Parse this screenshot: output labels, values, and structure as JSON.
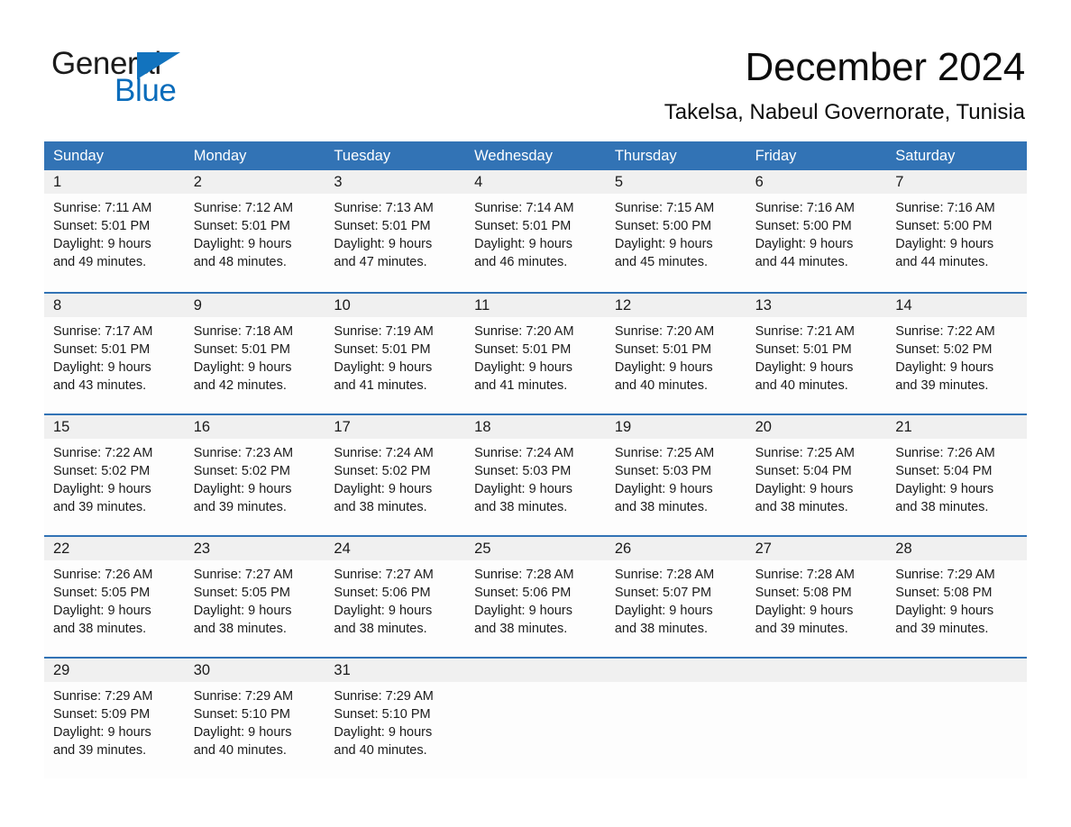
{
  "brand": {
    "name_part1": "General",
    "name_part2": "Blue",
    "accent_color": "#1273be",
    "blue_text_color": "#0a6cbb"
  },
  "header": {
    "month_title": "December 2024",
    "location": "Takelsa, Nabeul Governorate, Tunisia"
  },
  "calendar": {
    "header_color": "#3273b5",
    "day_band_color": "#f0f0f0",
    "weekdays": [
      "Sunday",
      "Monday",
      "Tuesday",
      "Wednesday",
      "Thursday",
      "Friday",
      "Saturday"
    ],
    "weeks": [
      [
        {
          "day": "1",
          "sunrise": "Sunrise: 7:11 AM",
          "sunset": "Sunset: 5:01 PM",
          "daylight_line1": "Daylight: 9 hours",
          "daylight_line2": "and 49 minutes."
        },
        {
          "day": "2",
          "sunrise": "Sunrise: 7:12 AM",
          "sunset": "Sunset: 5:01 PM",
          "daylight_line1": "Daylight: 9 hours",
          "daylight_line2": "and 48 minutes."
        },
        {
          "day": "3",
          "sunrise": "Sunrise: 7:13 AM",
          "sunset": "Sunset: 5:01 PM",
          "daylight_line1": "Daylight: 9 hours",
          "daylight_line2": "and 47 minutes."
        },
        {
          "day": "4",
          "sunrise": "Sunrise: 7:14 AM",
          "sunset": "Sunset: 5:01 PM",
          "daylight_line1": "Daylight: 9 hours",
          "daylight_line2": "and 46 minutes."
        },
        {
          "day": "5",
          "sunrise": "Sunrise: 7:15 AM",
          "sunset": "Sunset: 5:00 PM",
          "daylight_line1": "Daylight: 9 hours",
          "daylight_line2": "and 45 minutes."
        },
        {
          "day": "6",
          "sunrise": "Sunrise: 7:16 AM",
          "sunset": "Sunset: 5:00 PM",
          "daylight_line1": "Daylight: 9 hours",
          "daylight_line2": "and 44 minutes."
        },
        {
          "day": "7",
          "sunrise": "Sunrise: 7:16 AM",
          "sunset": "Sunset: 5:00 PM",
          "daylight_line1": "Daylight: 9 hours",
          "daylight_line2": "and 44 minutes."
        }
      ],
      [
        {
          "day": "8",
          "sunrise": "Sunrise: 7:17 AM",
          "sunset": "Sunset: 5:01 PM",
          "daylight_line1": "Daylight: 9 hours",
          "daylight_line2": "and 43 minutes."
        },
        {
          "day": "9",
          "sunrise": "Sunrise: 7:18 AM",
          "sunset": "Sunset: 5:01 PM",
          "daylight_line1": "Daylight: 9 hours",
          "daylight_line2": "and 42 minutes."
        },
        {
          "day": "10",
          "sunrise": "Sunrise: 7:19 AM",
          "sunset": "Sunset: 5:01 PM",
          "daylight_line1": "Daylight: 9 hours",
          "daylight_line2": "and 41 minutes."
        },
        {
          "day": "11",
          "sunrise": "Sunrise: 7:20 AM",
          "sunset": "Sunset: 5:01 PM",
          "daylight_line1": "Daylight: 9 hours",
          "daylight_line2": "and 41 minutes."
        },
        {
          "day": "12",
          "sunrise": "Sunrise: 7:20 AM",
          "sunset": "Sunset: 5:01 PM",
          "daylight_line1": "Daylight: 9 hours",
          "daylight_line2": "and 40 minutes."
        },
        {
          "day": "13",
          "sunrise": "Sunrise: 7:21 AM",
          "sunset": "Sunset: 5:01 PM",
          "daylight_line1": "Daylight: 9 hours",
          "daylight_line2": "and 40 minutes."
        },
        {
          "day": "14",
          "sunrise": "Sunrise: 7:22 AM",
          "sunset": "Sunset: 5:02 PM",
          "daylight_line1": "Daylight: 9 hours",
          "daylight_line2": "and 39 minutes."
        }
      ],
      [
        {
          "day": "15",
          "sunrise": "Sunrise: 7:22 AM",
          "sunset": "Sunset: 5:02 PM",
          "daylight_line1": "Daylight: 9 hours",
          "daylight_line2": "and 39 minutes."
        },
        {
          "day": "16",
          "sunrise": "Sunrise: 7:23 AM",
          "sunset": "Sunset: 5:02 PM",
          "daylight_line1": "Daylight: 9 hours",
          "daylight_line2": "and 39 minutes."
        },
        {
          "day": "17",
          "sunrise": "Sunrise: 7:24 AM",
          "sunset": "Sunset: 5:02 PM",
          "daylight_line1": "Daylight: 9 hours",
          "daylight_line2": "and 38 minutes."
        },
        {
          "day": "18",
          "sunrise": "Sunrise: 7:24 AM",
          "sunset": "Sunset: 5:03 PM",
          "daylight_line1": "Daylight: 9 hours",
          "daylight_line2": "and 38 minutes."
        },
        {
          "day": "19",
          "sunrise": "Sunrise: 7:25 AM",
          "sunset": "Sunset: 5:03 PM",
          "daylight_line1": "Daylight: 9 hours",
          "daylight_line2": "and 38 minutes."
        },
        {
          "day": "20",
          "sunrise": "Sunrise: 7:25 AM",
          "sunset": "Sunset: 5:04 PM",
          "daylight_line1": "Daylight: 9 hours",
          "daylight_line2": "and 38 minutes."
        },
        {
          "day": "21",
          "sunrise": "Sunrise: 7:26 AM",
          "sunset": "Sunset: 5:04 PM",
          "daylight_line1": "Daylight: 9 hours",
          "daylight_line2": "and 38 minutes."
        }
      ],
      [
        {
          "day": "22",
          "sunrise": "Sunrise: 7:26 AM",
          "sunset": "Sunset: 5:05 PM",
          "daylight_line1": "Daylight: 9 hours",
          "daylight_line2": "and 38 minutes."
        },
        {
          "day": "23",
          "sunrise": "Sunrise: 7:27 AM",
          "sunset": "Sunset: 5:05 PM",
          "daylight_line1": "Daylight: 9 hours",
          "daylight_line2": "and 38 minutes."
        },
        {
          "day": "24",
          "sunrise": "Sunrise: 7:27 AM",
          "sunset": "Sunset: 5:06 PM",
          "daylight_line1": "Daylight: 9 hours",
          "daylight_line2": "and 38 minutes."
        },
        {
          "day": "25",
          "sunrise": "Sunrise: 7:28 AM",
          "sunset": "Sunset: 5:06 PM",
          "daylight_line1": "Daylight: 9 hours",
          "daylight_line2": "and 38 minutes."
        },
        {
          "day": "26",
          "sunrise": "Sunrise: 7:28 AM",
          "sunset": "Sunset: 5:07 PM",
          "daylight_line1": "Daylight: 9 hours",
          "daylight_line2": "and 38 minutes."
        },
        {
          "day": "27",
          "sunrise": "Sunrise: 7:28 AM",
          "sunset": "Sunset: 5:08 PM",
          "daylight_line1": "Daylight: 9 hours",
          "daylight_line2": "and 39 minutes."
        },
        {
          "day": "28",
          "sunrise": "Sunrise: 7:29 AM",
          "sunset": "Sunset: 5:08 PM",
          "daylight_line1": "Daylight: 9 hours",
          "daylight_line2": "and 39 minutes."
        }
      ],
      [
        {
          "day": "29",
          "sunrise": "Sunrise: 7:29 AM",
          "sunset": "Sunset: 5:09 PM",
          "daylight_line1": "Daylight: 9 hours",
          "daylight_line2": "and 39 minutes."
        },
        {
          "day": "30",
          "sunrise": "Sunrise: 7:29 AM",
          "sunset": "Sunset: 5:10 PM",
          "daylight_line1": "Daylight: 9 hours",
          "daylight_line2": "and 40 minutes."
        },
        {
          "day": "31",
          "sunrise": "Sunrise: 7:29 AM",
          "sunset": "Sunset: 5:10 PM",
          "daylight_line1": "Daylight: 9 hours",
          "daylight_line2": "and 40 minutes."
        },
        {
          "day": "",
          "sunrise": "",
          "sunset": "",
          "daylight_line1": "",
          "daylight_line2": ""
        },
        {
          "day": "",
          "sunrise": "",
          "sunset": "",
          "daylight_line1": "",
          "daylight_line2": ""
        },
        {
          "day": "",
          "sunrise": "",
          "sunset": "",
          "daylight_line1": "",
          "daylight_line2": ""
        },
        {
          "day": "",
          "sunrise": "",
          "sunset": "",
          "daylight_line1": "",
          "daylight_line2": ""
        }
      ]
    ]
  }
}
